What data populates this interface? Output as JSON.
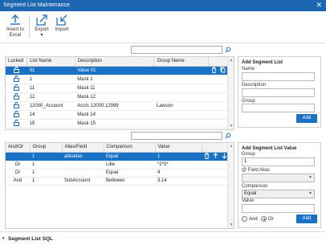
{
  "window": {
    "title": "Segment List Maintenance",
    "close_glyph": "✕"
  },
  "toolbar": {
    "insert_label_1": "Insert to",
    "insert_label_2": "Excel",
    "export_label": "Export",
    "export_caret": "▾",
    "import_label": "Import"
  },
  "segment_lists": {
    "columns": [
      "Locked",
      "List Name",
      "Description",
      "Group Name"
    ],
    "rows": [
      {
        "name": "01",
        "description": "Value 01",
        "group": ""
      },
      {
        "name": "1",
        "description": "Mask 1",
        "group": ""
      },
      {
        "name": "11",
        "description": "Mask 11",
        "group": ""
      },
      {
        "name": "12",
        "description": "Mask 12",
        "group": ""
      },
      {
        "name": "12000_Account",
        "description": "Accts 12000.12999",
        "group": "Lawson"
      },
      {
        "name": "14",
        "description": "Mask 14",
        "group": ""
      },
      {
        "name": "15",
        "description": "Mask 15",
        "group": ""
      }
    ]
  },
  "add_segment_list": {
    "title": "Add Segment List",
    "name_label": "Name",
    "description_label": "Description",
    "group_label": "Group",
    "add_label": "Add"
  },
  "segment_values": {
    "columns": [
      "And/Or",
      "Group",
      "Alias/Field",
      "Comparison",
      "Value"
    ],
    "rows": [
      {
        "andor": "",
        "group": "1",
        "alias": "adsadas",
        "comparison": "Equal",
        "value": "1"
      },
      {
        "andor": "Or",
        "group": "1",
        "alias": "",
        "comparison": "Like",
        "value": "*2*5*"
      },
      {
        "andor": "Or",
        "group": "1",
        "alias": "",
        "comparison": "Equal",
        "value": "4"
      },
      {
        "andor": "And",
        "group": "1",
        "alias": "SubAccount",
        "comparison": "Between",
        "value": "3.14"
      }
    ]
  },
  "add_segment_value": {
    "title": "Add Segment List Value",
    "group_label": "Group",
    "group_value": "1",
    "field_alias_label": "@ Field Alias",
    "field_alias_value": "",
    "comparison_label": "Comparison",
    "comparison_value": "Equal",
    "value_label": "Value",
    "value_value": "",
    "and_label": "And",
    "or_label": "Or",
    "add_label": "Add"
  },
  "footer": {
    "label": "Segment List SQL",
    "chevron": "▾"
  },
  "colors": {
    "accent": "#1a72c7",
    "titlebar": "#1d66b0"
  }
}
